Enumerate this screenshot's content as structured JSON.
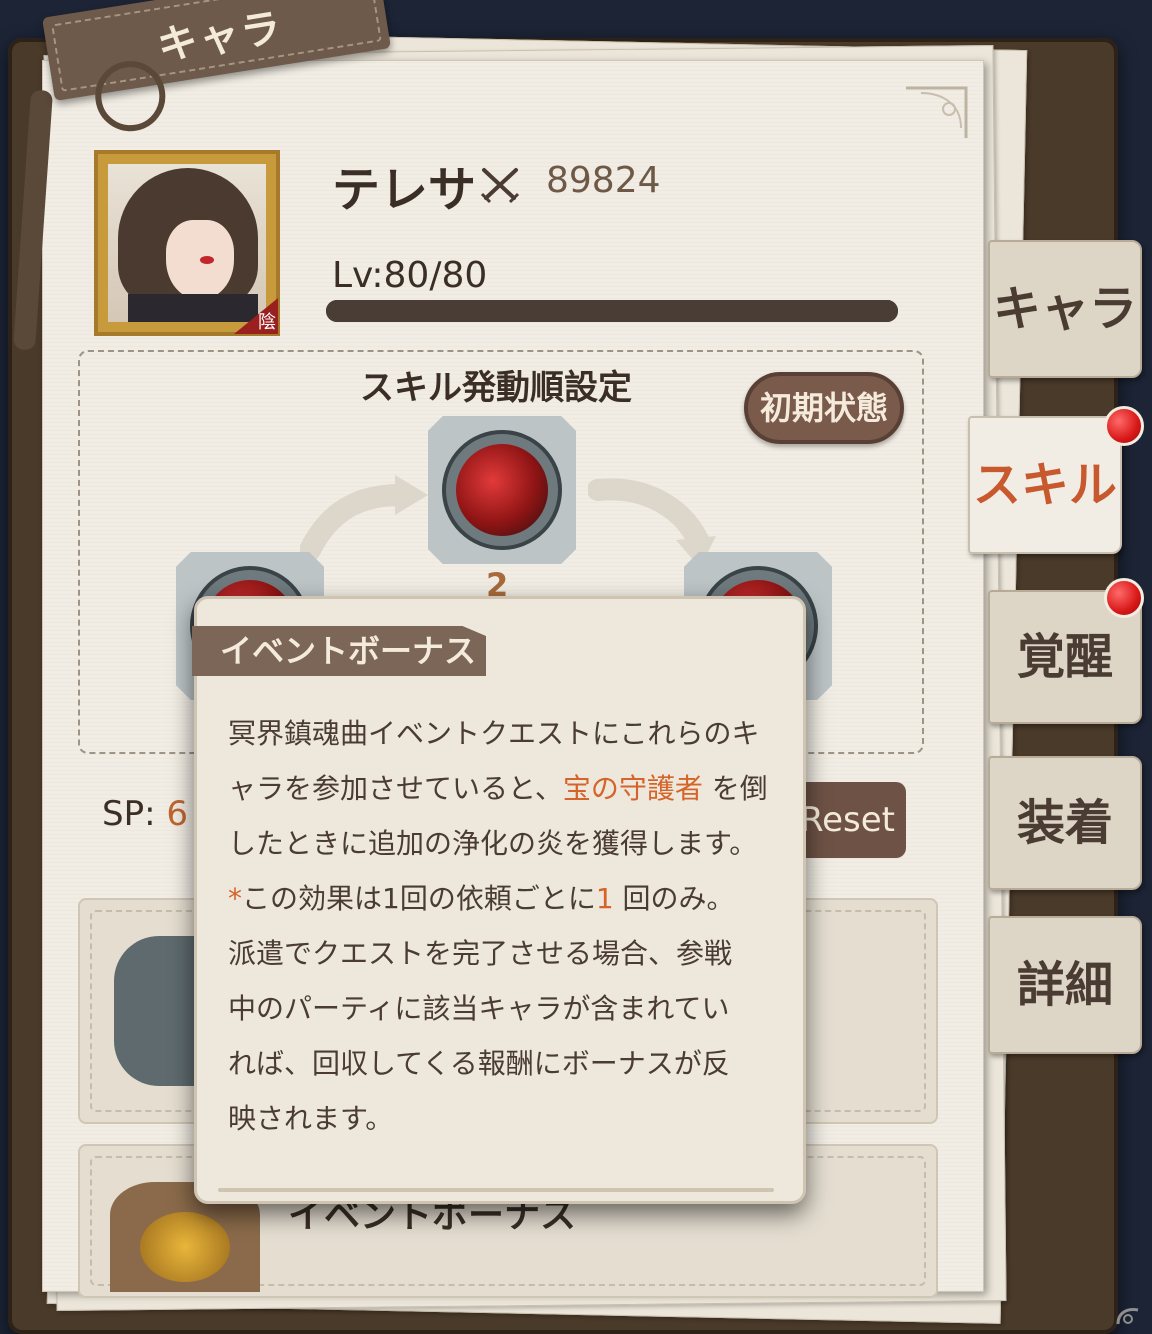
{
  "header_tag": {
    "title": "キャラ"
  },
  "character": {
    "name": "テレサ",
    "power": "89824",
    "level": "Lv:80/80",
    "level_progress": 1.0,
    "portrait_badge": "陰"
  },
  "skill_order": {
    "title": "スキル発動順設定",
    "reset_label": "初期状態",
    "center_slot_number": "2"
  },
  "sp": {
    "label": "SP:",
    "value": "6",
    "reset_label": "Reset"
  },
  "tabs": [
    {
      "label": "キャラ",
      "active": false,
      "notification": false
    },
    {
      "label": "スキル",
      "active": true,
      "notification": true
    },
    {
      "label": "覚醒",
      "active": false,
      "notification": true
    },
    {
      "label": "装着",
      "active": false,
      "notification": false
    },
    {
      "label": "詳細",
      "active": false,
      "notification": false
    }
  ],
  "tooltip": {
    "label": "イベントボーナス",
    "line1": "冥界鎮魂曲イベントクエストにこれらのキ",
    "line2_a": "ャラを参加させていると、",
    "line2_hl": "宝の守護者",
    "line2_b": " を倒",
    "line3": "したときに追加の浄化の炎を獲得します。",
    "line4_star": "*",
    "line4_a": "この効果は1回の依頼ごとに",
    "line4_hl": "1",
    "line4_b": " 回のみ。",
    "line5": "派遣でクエストを完了させる場合、参戦",
    "line6": "中のパーティに該当キャラが含まれてい",
    "line7": "れば、回収してくる報酬にボーナスが反",
    "line8": "映されます。"
  },
  "bottom_card": {
    "title": "イベントボーナス"
  },
  "colors": {
    "accent_orange": "#d4642a",
    "active_tab_text": "#c8582e",
    "notification_red": "#d81818"
  }
}
